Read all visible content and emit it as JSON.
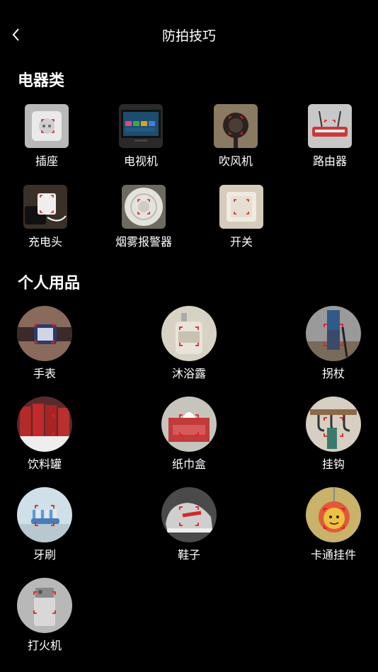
{
  "header": {
    "title": "防拍技巧",
    "back_icon": "chevron-left-icon"
  },
  "sections": [
    {
      "title": "电器类",
      "items": [
        {
          "label": "插座",
          "icon": "socket-icon"
        },
        {
          "label": "电视机",
          "icon": "tv-icon"
        },
        {
          "label": "吹风机",
          "icon": "hair-dryer-icon"
        },
        {
          "label": "路由器",
          "icon": "router-icon"
        },
        {
          "label": "充电头",
          "icon": "charger-icon"
        },
        {
          "label": "烟雾报警器",
          "icon": "smoke-alarm-icon"
        },
        {
          "label": "开关",
          "icon": "switch-icon"
        }
      ]
    },
    {
      "title": "个人用品",
      "items": [
        {
          "label": "手表",
          "icon": "watch-icon"
        },
        {
          "label": "沐浴露",
          "icon": "body-wash-icon"
        },
        {
          "label": "拐杖",
          "icon": "cane-icon"
        },
        {
          "label": "饮料罐",
          "icon": "beverage-can-icon"
        },
        {
          "label": "纸巾盒",
          "icon": "tissue-box-icon"
        },
        {
          "label": "挂钩",
          "icon": "hook-icon"
        },
        {
          "label": "牙刷",
          "icon": "toothbrush-icon"
        },
        {
          "label": "鞋子",
          "icon": "shoe-icon"
        },
        {
          "label": "卡通挂件",
          "icon": "cartoon-pendant-icon"
        },
        {
          "label": "打火机",
          "icon": "lighter-icon"
        }
      ]
    }
  ],
  "colors": {
    "background": "#000000",
    "text": "#ffffff",
    "frame_marker": "#e02020"
  }
}
